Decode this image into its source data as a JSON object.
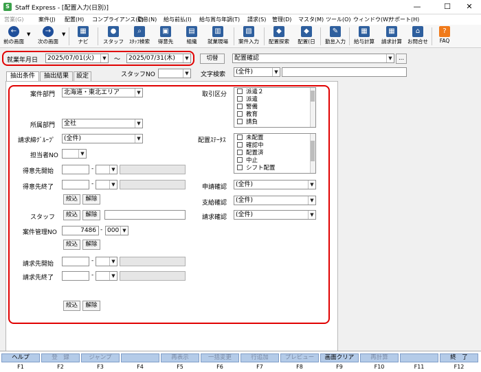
{
  "window": {
    "title": "Staff Express - [配置入力(日別)]",
    "controls": [
      "—",
      "☐",
      "✕"
    ]
  },
  "menu": [
    {
      "label": "営業(G)",
      "enabled": false
    },
    {
      "label": "案件(J)",
      "enabled": true
    },
    {
      "label": "配置(H)",
      "enabled": true
    },
    {
      "label": "コンプライアンス(C)",
      "enabled": true
    },
    {
      "label": "勤怠(N)",
      "enabled": true
    },
    {
      "label": "給与前払(I)",
      "enabled": true
    },
    {
      "label": "給与賞与年調(T)",
      "enabled": true
    },
    {
      "label": "請求(S)",
      "enabled": true
    },
    {
      "label": "管理(D)",
      "enabled": true
    },
    {
      "label": "マスタ(M)",
      "enabled": true
    },
    {
      "label": "ツール(O)",
      "enabled": true
    },
    {
      "label": "ウィンドウ(W)",
      "enabled": true
    },
    {
      "label": "サポート(H)",
      "enabled": true
    }
  ],
  "toolbar": [
    {
      "label": "前の画面",
      "icon": "←",
      "color": "#1f4f9a",
      "name": "back-button"
    },
    {
      "label": "次の画面",
      "icon": "→",
      "color": "#1f4f9a",
      "name": "forward-button"
    },
    {
      "label": "ナビ",
      "icon": "▦",
      "color": "#2e5f9e",
      "name": "navi-button"
    },
    {
      "label": "スタッフ",
      "icon": "●",
      "color": "#2e5f9e",
      "name": "staff-button"
    },
    {
      "label": "ｽﾀｯﾌ検索",
      "icon": "⌕",
      "color": "#2e5f9e",
      "name": "staff-search-button"
    },
    {
      "label": "得意先",
      "icon": "▣",
      "color": "#2e5f9e",
      "name": "customer-button"
    },
    {
      "label": "組織",
      "icon": "▤",
      "color": "#2e5f9e",
      "name": "organization-button"
    },
    {
      "label": "就業現場",
      "icon": "▥",
      "color": "#2e5f9e",
      "name": "worksite-button"
    },
    {
      "label": "案件入力",
      "icon": "▧",
      "color": "#2e5f9e",
      "name": "case-input-button"
    },
    {
      "label": "配置探索",
      "icon": "◆",
      "color": "#2e5f9e",
      "name": "placement-search-button"
    },
    {
      "label": "配置(日",
      "icon": "◆",
      "color": "#2e5f9e",
      "name": "placement-daily-button"
    },
    {
      "label": "勤怠入力",
      "icon": "✎",
      "color": "#2e5f9e",
      "name": "attendance-input-button"
    },
    {
      "label": "給与計算",
      "icon": "▦",
      "color": "#2e5f9e",
      "name": "payroll-button"
    },
    {
      "label": "請求計算",
      "icon": "▦",
      "color": "#2e5f9e",
      "name": "billing-button"
    },
    {
      "label": "お問合せ",
      "icon": "⌂",
      "color": "#2e5f9e",
      "name": "inquiry-button"
    },
    {
      "label": "FAQ",
      "icon": "?",
      "color": "#f07a1a",
      "name": "faq-button"
    }
  ],
  "period": {
    "label": "就業年月日",
    "from": "2025/07/01(火)",
    "tilde": "～",
    "to": "2025/07/31(木)"
  },
  "kirikae": "切替",
  "mode": "配置確認",
  "more": "...",
  "tabs": [
    "抽出条件",
    "抽出結果",
    "設定"
  ],
  "staff_no_label": "スタッフNO",
  "text_search": {
    "label": "文字検索",
    "value": "(全件)"
  },
  "form": {
    "case_dept": {
      "label": "案件部門",
      "value": "北海道・東北エリア"
    },
    "belong_dept": {
      "label": "所属部門",
      "value": "全社"
    },
    "billing_group": {
      "label": "請求締ｸﾞﾙｰﾌﾟ",
      "value": "(全件)"
    },
    "person_no": {
      "label": "担当者NO"
    },
    "cust_start": {
      "label": "得意先開始"
    },
    "cust_end": {
      "label": "得意先終了"
    },
    "narrow": "絞込",
    "clear": "解除",
    "staff": {
      "label": "スタッフ"
    },
    "case_no": {
      "label": "案件管理NO",
      "value": "7486",
      "sep": "-",
      "sub": "000"
    },
    "bill_start": {
      "label": "請求先開始"
    },
    "bill_end": {
      "label": "請求先終了"
    },
    "torihiki": {
      "label": "取引区分",
      "items": [
        "派遣２",
        "派遣",
        "警備",
        "教育",
        "請負"
      ]
    },
    "status": {
      "label": "配置ｽﾃｰﾀｽ",
      "items": [
        "未配置",
        "確認中",
        "配置済",
        "中止",
        "シフト配置"
      ]
    },
    "apply_check": {
      "label": "申請確認",
      "value": "(全件)"
    },
    "pay_check": {
      "label": "支給確認",
      "value": "(全件)"
    },
    "bill_check": {
      "label": "請求確認",
      "value": "(全件)"
    }
  },
  "fkeys": [
    {
      "label": "ヘルプ",
      "key": "F1",
      "enabled": true
    },
    {
      "label": "登　録",
      "key": "F2",
      "enabled": false
    },
    {
      "label": "ジャンプ",
      "key": "F3",
      "enabled": false
    },
    {
      "label": "",
      "key": "F4",
      "enabled": false
    },
    {
      "label": "再表示",
      "key": "F5",
      "enabled": false
    },
    {
      "label": "一括変更",
      "key": "F6",
      "enabled": false
    },
    {
      "label": "行追加",
      "key": "F7",
      "enabled": false
    },
    {
      "label": "プレビュー",
      "key": "F8",
      "enabled": false
    },
    {
      "label": "画面クリア",
      "key": "F9",
      "enabled": true
    },
    {
      "label": "再計算",
      "key": "F10",
      "enabled": false
    },
    {
      "label": "",
      "key": "F11",
      "enabled": false
    },
    {
      "label": "終　了",
      "key": "F12",
      "enabled": true
    }
  ]
}
